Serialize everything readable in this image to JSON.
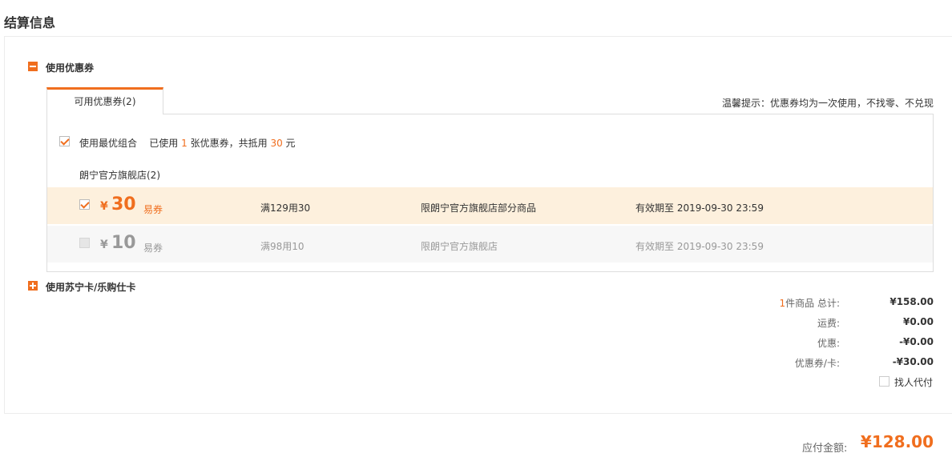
{
  "page_title": "结算信息",
  "coupon_section": {
    "label": "使用优惠券",
    "tab_label": "可用优惠券(2)",
    "tip": "温馨提示：优惠券均为一次使用，不找零、不兑现",
    "combo": {
      "label": "使用最优组合",
      "prefix": "已使用",
      "count": "1",
      "middle": "张优惠券，共抵用",
      "amount": "30",
      "suffix": "元"
    },
    "store": "朗宁官方旗舰店(2)",
    "coupons": [
      {
        "checked": true,
        "currency": "¥",
        "amount": "30",
        "type": "易券",
        "condition": "满129用30",
        "scope": "限朗宁官方旗舰店部分商品",
        "validity": "有效期至 2019-09-30 23:59"
      },
      {
        "checked": false,
        "currency": "¥",
        "amount": "10",
        "type": "易券",
        "condition": "满98用10",
        "scope": "限朗宁官方旗舰店",
        "validity": "有效期至 2019-09-30 23:59"
      }
    ]
  },
  "card_section": {
    "label": "使用苏宁卡/乐购仕卡"
  },
  "summary": {
    "items_count": "1",
    "items_label": "件商品 总计:",
    "total": "¥158.00",
    "shipping_label": "运费:",
    "shipping": "¥0.00",
    "discount_label": "优惠:",
    "discount": "-¥0.00",
    "coupon_label": "优惠券/卡:",
    "coupon": "-¥30.00",
    "proxy_pay_label": "找人代付"
  },
  "payable": {
    "label": "应付金额:",
    "value": "¥128.00"
  },
  "colors": {
    "accent": "#f06e1e",
    "active_row_bg": "#fdf0dd",
    "inactive_row_bg": "#f7f7f7"
  }
}
